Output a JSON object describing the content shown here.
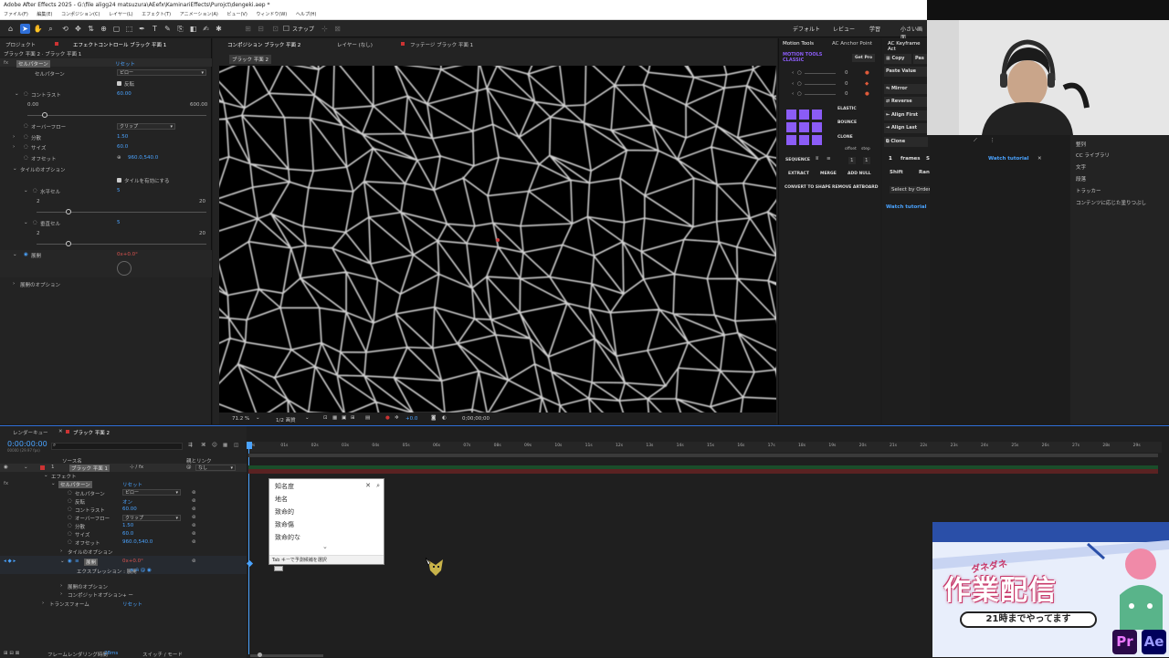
{
  "app": {
    "title": "Adobe After Effects 2025 - G:\\file aligg24 matsuzura\\AEefx\\KaminariEffects\\Purojct\\dengeki.aep *",
    "menu": [
      "ファイル(F)",
      "編集(E)",
      "コンポジション(C)",
      "レイヤー(L)",
      "エフェクト(T)",
      "アニメーション(A)",
      "ビュー(V)",
      "ウィンドウ(W)",
      "ヘルプ(H)"
    ],
    "snap_label": "スナップ",
    "workspaces": [
      "デフォルト",
      "レビュー",
      "学習",
      "小さい画面"
    ]
  },
  "effect_panel": {
    "tabs": [
      "プロジェクト",
      "エフェクトコントロール ブラック 平面 1"
    ],
    "layer_path": "ブラック 平面 2 · ブラック 平面 1",
    "effect_name": "セルパターン",
    "reset": "リセット",
    "cell_pattern_label": "セルパターン",
    "cell_pattern_value": "ピロー",
    "invert": "反転",
    "contrast_label": "コントラスト",
    "contrast_value": "60.00",
    "contrast_min": "0.00",
    "contrast_max": "600.00",
    "overflow_label": "オーバーフロー",
    "overflow_value": "クリップ",
    "disperse_label": "分散",
    "disperse_value": "1.50",
    "size_label": "サイズ",
    "size_value": "60.0",
    "offset_label": "オフセット",
    "offset_value": "960.0,540.0",
    "tile_options": "タイルのオプション",
    "enable_tile": "タイルを有効にする",
    "h_cells": "水平セル",
    "h_value": "5",
    "h_min": "2",
    "h_max": "20",
    "v_cells": "垂直セル",
    "v_value": "5",
    "v_min": "2",
    "v_max": "20",
    "evolution_label": "展開",
    "evolution_value": "0x+0.0°",
    "evolution_options": "展開のオプション"
  },
  "comp_panel": {
    "tabs": [
      "コンポジション ブラック 平面 2",
      "レイヤー (なし)",
      "フッテージ ブラック 平面 1"
    ],
    "comp_chip": "ブラック 平面 2",
    "zoom": "71.2 %",
    "resolution": "1/2 画質",
    "exposure": "+0.0",
    "timecode": "0;00;00;00"
  },
  "motion_tools": {
    "tabs": [
      "Motion Tools",
      "AC Anchor Point"
    ],
    "brand_line1": "MOTION TOOLS",
    "brand_line2": "CLASSIC",
    "get_pro": "Get Pro",
    "values": [
      "0",
      "0",
      "0"
    ],
    "elastic": "ELASTIC",
    "bounce": "BOUNCE",
    "clone": "CLONE",
    "offset": "offset",
    "step": "step",
    "sequence": "SEQUENCE",
    "seq_values": [
      "1",
      "1"
    ],
    "extract": "EXTRACT",
    "merge": "MERGE",
    "add_null": "ADD NULL",
    "convert": "CONVERT TO SHAPE",
    "remove_artboard": "REMOVE ARTBOARD",
    "watch_tutorial": "Watch tutorial"
  },
  "keyframe_panel": {
    "tab": "AC Keyframe Act",
    "copy": "Copy",
    "paste": "Pas",
    "paste_value": "Paste Value",
    "mirror": "Mirror",
    "reverse": "Reverse",
    "align_first": "Align First",
    "align_last": "Align Last",
    "clone": "Clone",
    "frames_value": "1",
    "frames": "frames",
    "shift": "Shift",
    "shift2": "Shift",
    "random": "Random",
    "select_by_order": "Select by Order",
    "watch_tutorial": "Watch tutorial",
    "watch_tutorial_2": "Watch tutorial"
  },
  "right_list": [
    "整列",
    "CC ライブラリ",
    "文字",
    "段落",
    "トラッカー",
    "コンテンツに応じた塗りつぶし"
  ],
  "timeline": {
    "tabs": [
      "レンダーキュー",
      "ブラック 平面 2"
    ],
    "timecode": "0:00:00:00",
    "fps": "00000 (29.97 fps)",
    "col_source": "ソース名",
    "col_parent": "親とリンク",
    "parent_value": "なし",
    "layer_number": "1",
    "layer_name": "ブラック 平面 1",
    "effects": "エフェクト",
    "cell_pattern": "セルパターン",
    "reset": "リセット",
    "props": [
      {
        "label": "セルパターン",
        "value": "ピロー"
      },
      {
        "label": "反転",
        "value": "オン"
      },
      {
        "label": "コントラスト",
        "value": "60.00"
      },
      {
        "label": "オーバーフロー",
        "value": "クリップ"
      },
      {
        "label": "分散",
        "value": "1.50"
      },
      {
        "label": "サイズ",
        "value": "60.0"
      },
      {
        "label": "オフセット",
        "value": "960.0,540.0"
      }
    ],
    "tile_options": "タイルのオプション",
    "evolution": "展開",
    "evolution_value": "0x+0.0°",
    "expression": "エクスプレッション : 展開",
    "evolution_options": "展開のオプション",
    "composite_options": "コンポジットオプション",
    "composite_value": "+ ー",
    "transform": "トランスフォーム",
    "transform_reset": "リセット",
    "frame_render_time_label": "フレームレンダリング時間",
    "frame_render_time": "28ms",
    "switch_mode": "スイッチ / モード",
    "ruler": [
      "0s",
      "01s",
      "02s",
      "03s",
      "04s",
      "05s",
      "06s",
      "07s",
      "08s",
      "09s",
      "10s",
      "11s",
      "12s",
      "13s",
      "14s",
      "15s",
      "16s",
      "17s",
      "18s",
      "19s",
      "20s",
      "21s",
      "22s",
      "23s",
      "24s",
      "25s",
      "26s",
      "27s",
      "28s",
      "29s"
    ]
  },
  "ime_popup": {
    "items": [
      "知名度",
      "地名",
      "致命的",
      "致命傷",
      "致命的な"
    ],
    "footer": "Tab キーで予測候補を選択"
  },
  "promo": {
    "kana": "ダネダネ",
    "title": "作業配信",
    "subtitle": "21時までやってます",
    "apps": [
      "Pr",
      "Ae"
    ]
  },
  "colors": {
    "accent": "#2f6fd8",
    "value_blue": "#4aa3ff",
    "mt_purple": "#8b5cf6"
  }
}
